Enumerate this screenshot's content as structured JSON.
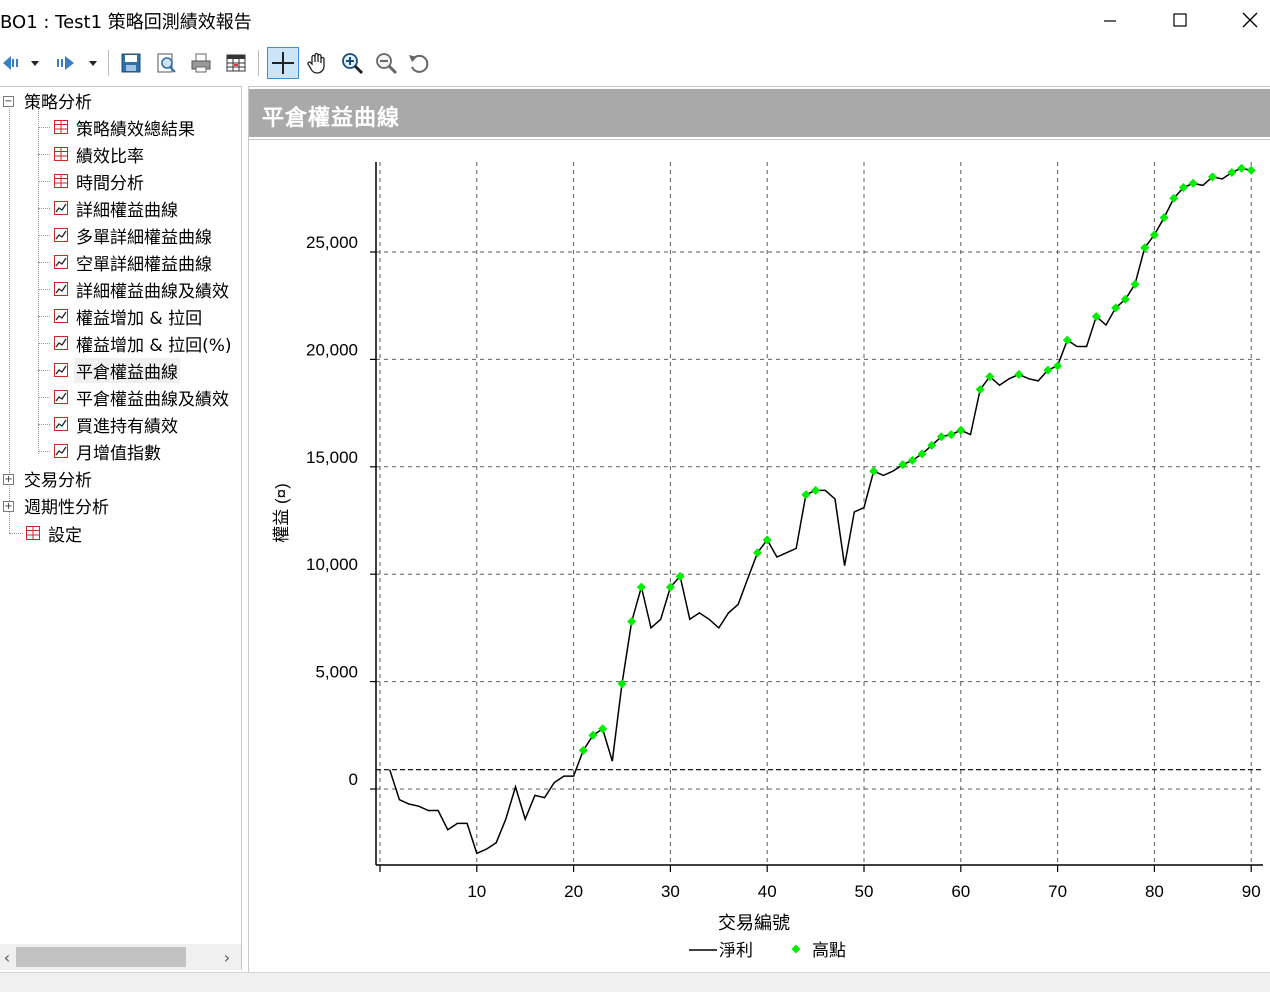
{
  "window": {
    "title": "BO1 : Test1 策略回測績效報告",
    "controls": {
      "minimize": "minimize",
      "maximize": "maximize",
      "close": "close"
    }
  },
  "toolbar": {
    "buttons": [
      {
        "name": "back-icon",
        "label": "back"
      },
      {
        "name": "back-dropdown-icon",
        "label": "dropdown"
      },
      {
        "name": "forward-icon",
        "label": "forward"
      },
      {
        "name": "forward-dropdown-icon",
        "label": "dropdown"
      },
      {
        "name": "save-icon",
        "label": "save"
      },
      {
        "name": "preview-icon",
        "label": "print preview"
      },
      {
        "name": "print-icon",
        "label": "print"
      },
      {
        "name": "table-icon",
        "label": "table"
      },
      {
        "name": "crosshair-icon",
        "label": "crosshair",
        "active": true
      },
      {
        "name": "hand-pan-icon",
        "label": "pan"
      },
      {
        "name": "zoom-in-icon",
        "label": "zoom in"
      },
      {
        "name": "zoom-out-icon",
        "label": "zoom out"
      },
      {
        "name": "reset-icon",
        "label": "reset"
      }
    ]
  },
  "tree": {
    "groups": [
      {
        "label": "策略分析",
        "expanded": true,
        "items": [
          {
            "label": "策略績效總結果",
            "icon": "table-icon"
          },
          {
            "label": "績效比率",
            "icon": "table-icon"
          },
          {
            "label": "時間分析",
            "icon": "table-icon"
          },
          {
            "label": "詳細權益曲線",
            "icon": "chart-icon"
          },
          {
            "label": "多單詳細權益曲線",
            "icon": "chart-icon"
          },
          {
            "label": "空單詳細權益曲線",
            "icon": "chart-icon"
          },
          {
            "label": "詳細權益曲線及績效",
            "icon": "chart-icon"
          },
          {
            "label": "權益增加 & 拉回",
            "icon": "chart-icon"
          },
          {
            "label": "權益增加 & 拉回(%)",
            "icon": "chart-icon"
          },
          {
            "label": "平倉權益曲線",
            "icon": "chart-icon",
            "selected": true
          },
          {
            "label": "平倉權益曲線及績效",
            "icon": "chart-icon"
          },
          {
            "label": "買進持有績效",
            "icon": "chart-icon"
          },
          {
            "label": "月增值指數",
            "icon": "chart-icon"
          }
        ]
      },
      {
        "label": "交易分析",
        "expanded": false
      },
      {
        "label": "週期性分析",
        "expanded": false
      },
      {
        "label": "設定",
        "icon": "table-icon",
        "leaf": true
      }
    ]
  },
  "header": {
    "title": "平倉權益曲線"
  },
  "chart_data": {
    "type": "line",
    "xlabel": "交易編號",
    "ylabel": "權益 (¤)",
    "xlim": [
      0,
      90
    ],
    "ylim": [
      -3500,
      29500
    ],
    "xticks": [
      10,
      20,
      30,
      40,
      50,
      60,
      70,
      80,
      90
    ],
    "yticks": [
      0,
      5000,
      10000,
      15000,
      20000,
      25000
    ],
    "ytick_labels": [
      "0",
      "5,000",
      "10,000",
      "15,000",
      "20,000",
      "25,000"
    ],
    "grid": true,
    "legend": {
      "position": "bottom-center",
      "entries": [
        "淨利",
        "高點"
      ]
    },
    "colors": {
      "line": "#000000",
      "highs": "#00ee00",
      "grid": "#5a5a5a",
      "baseline": "#000000"
    },
    "baseline_value": 900,
    "series": [
      {
        "name": "淨利",
        "x": [
          1,
          2,
          3,
          4,
          5,
          6,
          7,
          8,
          9,
          10,
          11,
          12,
          13,
          14,
          15,
          16,
          17,
          18,
          19,
          20,
          21,
          22,
          23,
          24,
          25,
          26,
          27,
          28,
          29,
          30,
          31,
          32,
          33,
          34,
          35,
          36,
          37,
          38,
          39,
          40,
          41,
          42,
          43,
          44,
          45,
          46,
          47,
          48,
          49,
          50,
          51,
          52,
          53,
          54,
          55,
          56,
          57,
          58,
          59,
          60,
          61,
          62,
          63,
          64,
          65,
          66,
          67,
          68,
          69,
          70,
          71,
          72,
          73,
          74,
          75,
          76,
          77,
          78,
          79,
          80,
          81,
          82,
          83,
          84,
          85,
          86,
          87,
          88,
          89,
          90
        ],
        "y": [
          900,
          -500,
          -700,
          -800,
          -1000,
          -1000,
          -1900,
          -1600,
          -1600,
          -3000,
          -2800,
          -2500,
          -1400,
          100,
          -1400,
          -300,
          -400,
          300,
          600,
          600,
          1800,
          2500,
          2800,
          1300,
          4900,
          7800,
          9400,
          7500,
          7900,
          9400,
          9900,
          7900,
          8200,
          7900,
          7500,
          8200,
          8600,
          9800,
          11000,
          11600,
          10800,
          11000,
          11200,
          13700,
          13900,
          13900,
          13500,
          10400,
          12900,
          13100,
          14800,
          14600,
          14800,
          15100,
          15300,
          15600,
          16000,
          16400,
          16500,
          16700,
          16500,
          18600,
          19200,
          18800,
          19100,
          19300,
          19100,
          19000,
          19500,
          19700,
          20900,
          20600,
          20600,
          22000,
          21600,
          22400,
          22800,
          23500,
          25200,
          25800,
          26600,
          27500,
          28000,
          28200,
          28100,
          28500,
          28400,
          28700,
          28900,
          28800
        ]
      },
      {
        "name": "高點",
        "x": [
          21,
          22,
          23,
          25,
          26,
          27,
          30,
          31,
          39,
          40,
          44,
          45,
          51,
          54,
          55,
          56,
          57,
          58,
          59,
          60,
          62,
          63,
          66,
          69,
          70,
          71,
          74,
          76,
          77,
          78,
          79,
          80,
          81,
          82,
          83,
          84,
          86,
          88,
          89,
          90
        ],
        "y": [
          1800,
          2500,
          2800,
          4900,
          7800,
          9400,
          9400,
          9900,
          11000,
          11600,
          13700,
          13900,
          14800,
          15100,
          15300,
          15600,
          16000,
          16400,
          16500,
          16700,
          18600,
          19200,
          19300,
          19500,
          19700,
          20900,
          22000,
          22400,
          22800,
          23500,
          25200,
          25800,
          26600,
          27500,
          28000,
          28200,
          28500,
          28700,
          28900,
          28800
        ]
      }
    ]
  }
}
